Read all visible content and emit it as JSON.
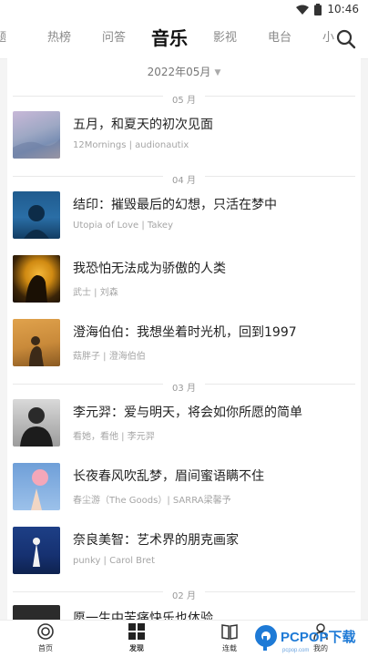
{
  "status_bar": {
    "time": "10:46"
  },
  "top_nav": {
    "tabs": [
      {
        "label": "题"
      },
      {
        "label": "热榜"
      },
      {
        "label": "问答"
      },
      {
        "label": "音乐"
      },
      {
        "label": "影视"
      },
      {
        "label": "电台"
      },
      {
        "label": "小"
      }
    ],
    "active_tab": "音乐"
  },
  "filter": {
    "date_label": "2022年05月"
  },
  "months": [
    {
      "label": "05 月"
    },
    {
      "label": "04 月"
    },
    {
      "label": "03 月"
    },
    {
      "label": "02 月"
    }
  ],
  "items": [
    {
      "title": "五月，和夏天的初次见面",
      "meta": "12Mornings | audionautix"
    },
    {
      "title": "结印：摧毁最后的幻想，只活在梦中",
      "meta": "Utopia of Love | Takey"
    },
    {
      "title": "我恐怕无法成为骄傲的人类",
      "meta": "武士 | 刘森"
    },
    {
      "title": "澄海伯伯：我想坐着时光机，回到1997",
      "meta": "菇胖子 | 澄海伯伯"
    },
    {
      "title": "李元羿：爱与明天，将会如你所愿的简单",
      "meta": "看她，看他 | 李元羿"
    },
    {
      "title": "长夜春风吹乱梦，眉间蜜语瞒不住",
      "meta": "春尘游（The Goods）| SARRA梁馨予"
    },
    {
      "title": "奈良美智：艺术界的朋克画家",
      "meta": "punky | Carol Bret"
    },
    {
      "title": "愿一生中苦痛快乐也体验",
      "meta": ""
    }
  ],
  "bottom_nav": {
    "items": [
      {
        "label": "首页"
      },
      {
        "label": "发现"
      },
      {
        "label": "连载"
      },
      {
        "label": "我的"
      }
    ]
  },
  "watermark": {
    "text": "PCPOP下载",
    "sub": "pcpop.com"
  }
}
